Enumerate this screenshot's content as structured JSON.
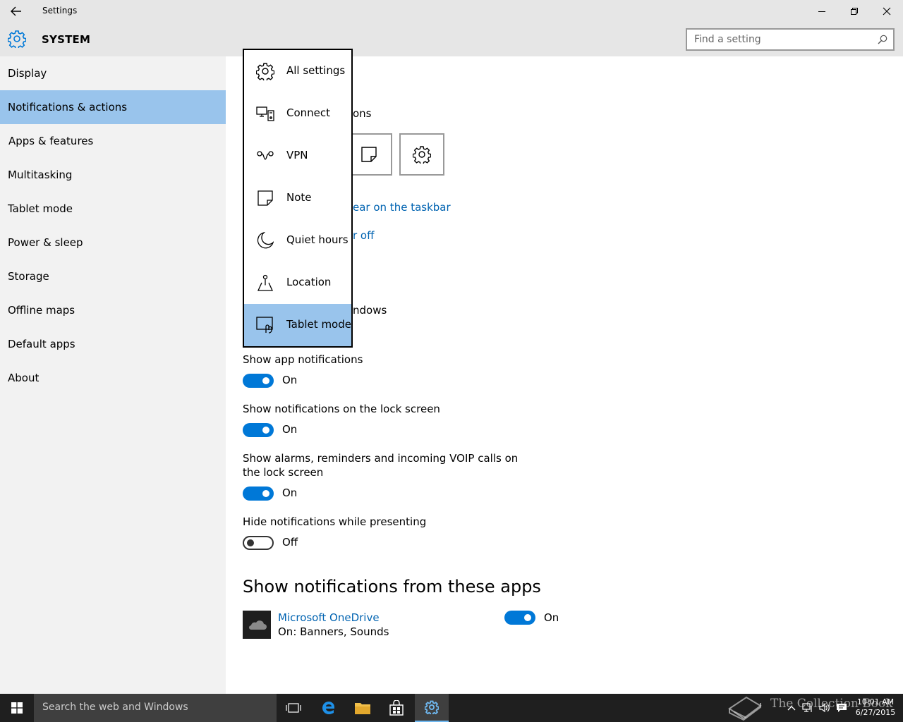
{
  "window": {
    "title": "Settings",
    "section_title": "SYSTEM"
  },
  "search": {
    "placeholder": "Find a setting"
  },
  "sidebar": {
    "items": [
      {
        "label": "Display",
        "active": false
      },
      {
        "label": "Notifications & actions",
        "active": true
      },
      {
        "label": "Apps & features",
        "active": false
      },
      {
        "label": "Multitasking",
        "active": false
      },
      {
        "label": "Tablet mode",
        "active": false
      },
      {
        "label": "Power & sleep",
        "active": false
      },
      {
        "label": "Storage",
        "active": false
      },
      {
        "label": "Offline maps",
        "active": false
      },
      {
        "label": "Default apps",
        "active": false
      },
      {
        "label": "About",
        "active": false
      }
    ]
  },
  "main": {
    "partial_heading_tail": "ons",
    "link_taskbar_tail": "ear on the taskbar",
    "link_off_tail": "r off",
    "partial_windows_tail": "ndows",
    "settings": [
      {
        "label": "Show app notifications",
        "state": "On"
      },
      {
        "label": "Show notifications on the lock screen",
        "state": "On"
      },
      {
        "label": "Show alarms, reminders and incoming VOIP calls on the lock screen",
        "state": "On"
      },
      {
        "label": "Hide notifications while presenting",
        "state": "Off"
      }
    ],
    "apps_heading": "Show notifications from these apps",
    "apps": [
      {
        "name": "Microsoft OneDrive",
        "detail": "On: Banners, Sounds",
        "state": "On"
      }
    ]
  },
  "flyout": {
    "items": [
      {
        "label": "All settings",
        "icon": "gear-icon",
        "selected": false
      },
      {
        "label": "Connect",
        "icon": "connect-icon",
        "selected": false
      },
      {
        "label": "VPN",
        "icon": "vpn-icon",
        "selected": false
      },
      {
        "label": "Note",
        "icon": "note-icon",
        "selected": false
      },
      {
        "label": "Quiet hours",
        "icon": "moon-icon",
        "selected": false
      },
      {
        "label": "Location",
        "icon": "location-icon",
        "selected": false
      },
      {
        "label": "Tablet mode",
        "icon": "tablet-mode-icon",
        "selected": true
      }
    ]
  },
  "taskbar": {
    "search_text": "Search the web and Windows",
    "time": "10:01 AM",
    "date": "6/27/2015",
    "watermark": "The Collection Book"
  },
  "colors": {
    "accent": "#0078d7",
    "selected_bg": "#99c4ec",
    "link": "#0063b1"
  }
}
